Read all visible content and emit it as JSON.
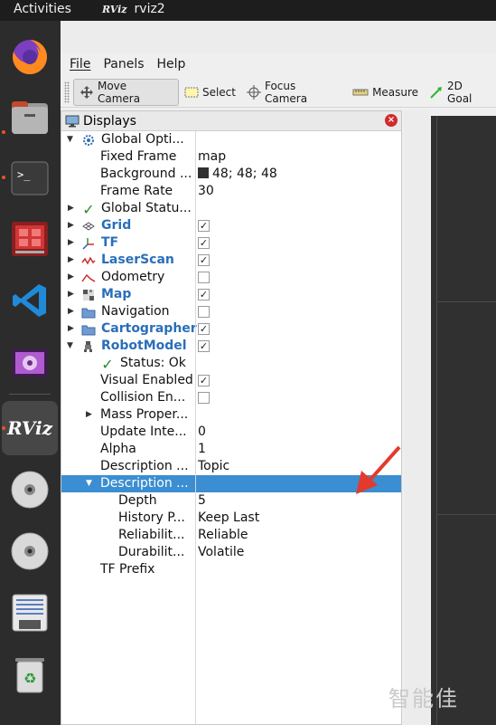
{
  "topbar": {
    "activities": "Activities",
    "app_name": "rviz2",
    "app_mini": "RViz"
  },
  "dock": {
    "items": [
      "firefox-icon",
      "files-icon",
      "terminal-icon",
      "screenshot-icon",
      "vscode-icon",
      "video-icon",
      "rviz-icon",
      "disc-icon",
      "disc-icon",
      "text-editor-icon",
      "trash-icon"
    ],
    "rviz_label": "RViz"
  },
  "menubar": {
    "file": "File",
    "panels": "Panels",
    "help": "Help"
  },
  "toolbar": {
    "move_camera": "Move Camera",
    "select": "Select",
    "focus_camera": "Focus Camera",
    "measure": "Measure",
    "goal": "2D Goal"
  },
  "panel": {
    "title": "Displays",
    "rows": [
      {
        "label": "Global Opti...",
        "value": ""
      },
      {
        "label": "Fixed Frame",
        "value": "map"
      },
      {
        "label": "Background ...",
        "value": "48; 48; 48"
      },
      {
        "label": "Frame Rate",
        "value": "30"
      },
      {
        "label": "Global Statu...",
        "value": ""
      },
      {
        "label": "Grid",
        "checked": true
      },
      {
        "label": "TF",
        "checked": true
      },
      {
        "label": "LaserScan",
        "checked": true
      },
      {
        "label": "Odometry",
        "checked": false
      },
      {
        "label": "Map",
        "checked": true
      },
      {
        "label": "Navigation",
        "checked": false
      },
      {
        "label": "Cartographer",
        "checked": true
      },
      {
        "label": "RobotModel",
        "checked": true
      },
      {
        "label": "Status: Ok",
        "value": ""
      },
      {
        "label": "Visual Enabled",
        "checked": true
      },
      {
        "label": "Collision En...",
        "checked": false
      },
      {
        "label": "Mass Proper...",
        "value": ""
      },
      {
        "label": "Update Inte...",
        "value": "0"
      },
      {
        "label": "Alpha",
        "value": "1"
      },
      {
        "label": "Description ...",
        "value": "Topic"
      },
      {
        "label": "Description ...",
        "value": ""
      },
      {
        "label": "Depth",
        "value": "5"
      },
      {
        "label": "History P...",
        "value": "Keep Last"
      },
      {
        "label": "Reliabilit...",
        "value": "Reliable"
      },
      {
        "label": "Durabilit...",
        "value": "Volatile"
      },
      {
        "label": "TF Prefix",
        "value": ""
      }
    ]
  },
  "watermark": "智能佳",
  "colors": {
    "selection": "#3b8ed1",
    "accent_blue": "#2a6fb8",
    "arrow_red": "#e23b2e",
    "background": "#303030"
  }
}
